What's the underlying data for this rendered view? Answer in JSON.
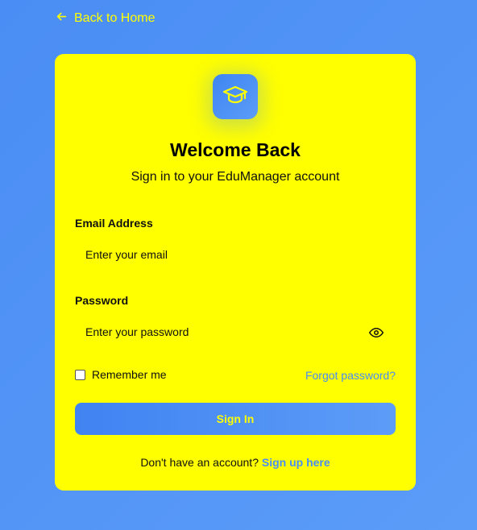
{
  "nav": {
    "back_label": "Back to Home",
    "back_icon": "arrow-left-icon"
  },
  "card": {
    "logo_icon": "graduation-cap-icon",
    "title": "Welcome Back",
    "subtitle": "Sign in to your EduManager account"
  },
  "form": {
    "email_label": "Email Address",
    "email_placeholder": "Enter your email",
    "email_value": "",
    "password_label": "Password",
    "password_placeholder": "Enter your password",
    "password_value": "",
    "password_toggle_icon": "eye-icon",
    "remember_label": "Remember me",
    "remember_checked": false,
    "forgot_label": "Forgot password?",
    "submit_label": "Sign In"
  },
  "footer": {
    "prompt": "Don't have an account?",
    "signup_label": "Sign up here"
  },
  "colors": {
    "page_background": "#4a8df4",
    "card_background": "#ffff00",
    "accent": "#4a8df4",
    "button_text": "#ffff00"
  }
}
